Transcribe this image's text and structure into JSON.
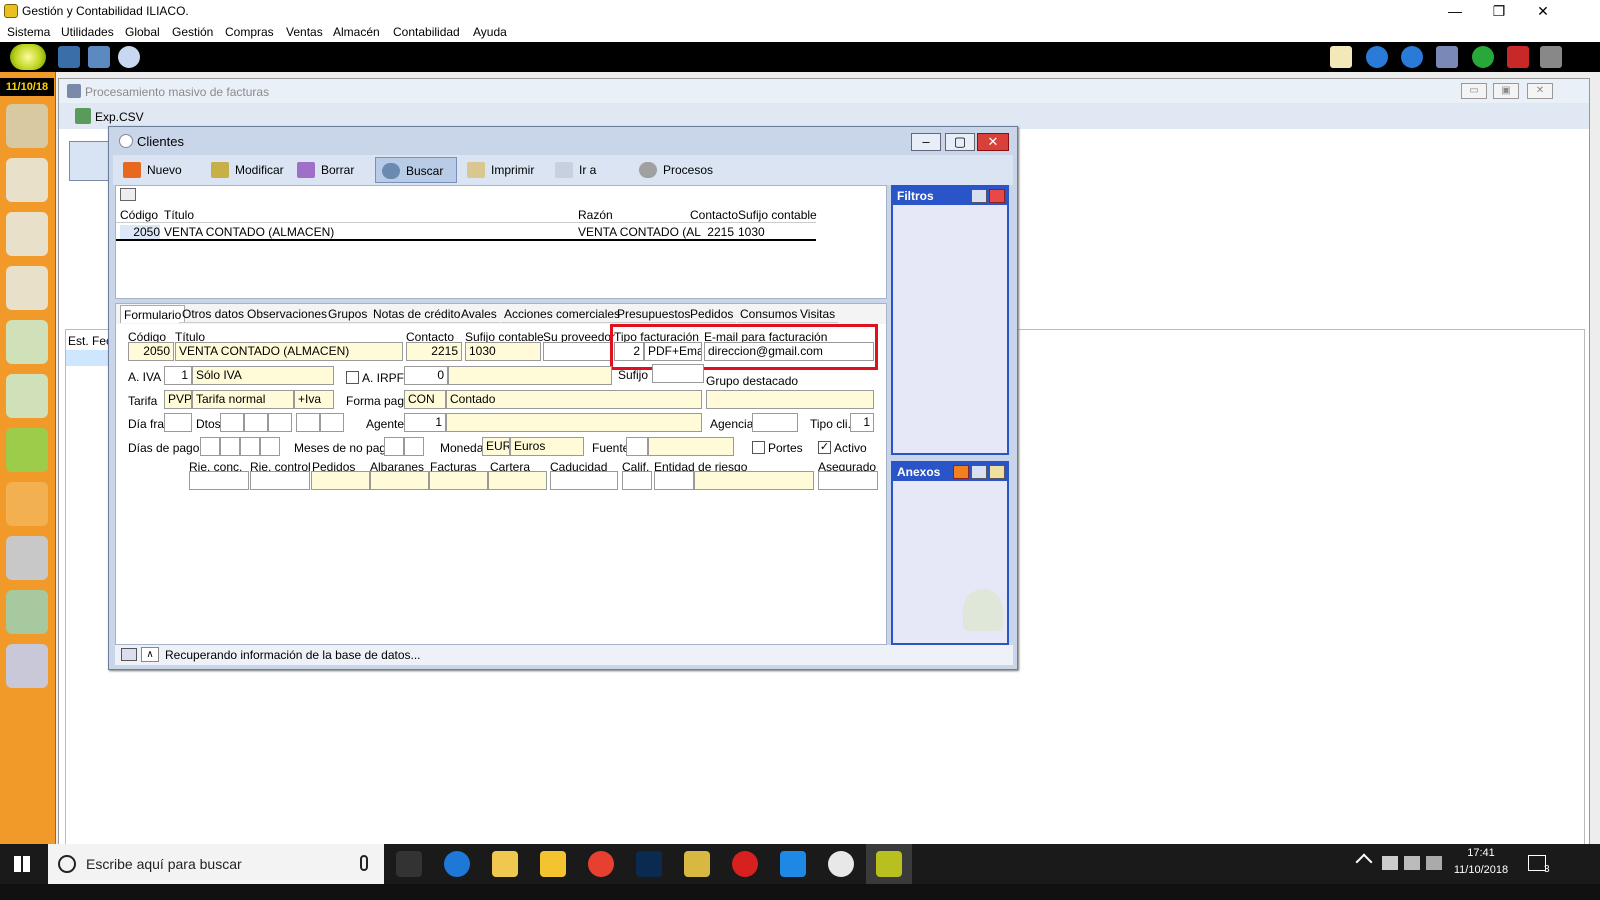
{
  "app": {
    "title": "Gestión y Contabilidad ILIACO.",
    "minimize": "—",
    "maximize": "❐",
    "close": "✕"
  },
  "menu": [
    "Sistema",
    "Utilidades",
    "Global",
    "Gestión",
    "Compras",
    "Ventas",
    "Almacén",
    "Contabilidad",
    "Ayuda"
  ],
  "launcher": {
    "date": "11/10/18"
  },
  "proc_window": {
    "title": "Procesamiento masivo de facturas",
    "export_label": "Exp.CSV",
    "grid_cols": [
      "Est.",
      "Fec"
    ],
    "btn_min": "▭",
    "btn_max": "▣",
    "btn_close": "✕"
  },
  "clientes": {
    "title": "Clientes",
    "btn_min": "–",
    "btn_max": "▢",
    "btn_close": "✕",
    "toolbar": [
      "Nuevo",
      "Modificar",
      "Borrar",
      "Buscar",
      "Imprimir",
      "Ir a",
      "Procesos"
    ],
    "list": {
      "columns": [
        "Código",
        "Título",
        "Razón",
        "Contacto",
        "Sufijo contable"
      ],
      "rows": [
        {
          "codigo": "2050",
          "titulo": "VENTA CONTADO (ALMACEN)",
          "razon": "VENTA CONTADO (AL",
          "contacto": "2215",
          "sufijo": "1030"
        }
      ]
    },
    "tabs": [
      "Formulario",
      "Otros datos",
      "Observaciones",
      "Grupos",
      "Notas de crédito",
      "Avales",
      "Acciones comerciales",
      "Presupuestos",
      "Pedidos",
      "Consumos",
      "Visitas"
    ],
    "form": {
      "codigo_label": "Código",
      "codigo": "2050",
      "titulo_label": "Título",
      "titulo": "VENTA CONTADO (ALMACEN)",
      "contacto_label": "Contacto",
      "contacto": "2215",
      "sufijo_label": "Sufijo contable",
      "sufijo": "1030",
      "proveedor_label": "Su proveedor",
      "proveedor": "",
      "tipo_fact_label": "Tipo facturación",
      "tipo_fact_num": "2",
      "tipo_fact": "PDF+Email",
      "email_label": "E-mail para facturación",
      "email": "direccion@gmail.com",
      "aiva_label": "A. IVA",
      "aiva_num": "1",
      "aiva": "Sólo IVA",
      "airpf_label": "A. IRPF",
      "airpf": "0",
      "sufijo2_label": "Sufijo",
      "grupo_label": "Grupo destacado",
      "tarifa_label": "Tarifa",
      "tarifa_code": "PVP",
      "tarifa": "Tarifa normal",
      "tarifa_iva": "+Iva",
      "formapago_label": "Forma pago",
      "formapago_code": "CON",
      "formapago": "Contado",
      "diafra_label": "Día fra",
      "dtos_label": "Dtos",
      "agente_label": "Agente",
      "agente": "1",
      "agencia_label": "Agencia",
      "tipocli_label": "Tipo cli.",
      "tipocli": "1",
      "diaspago_label": "Días de pago",
      "mesesnopago_label": "Meses de no pago",
      "moneda_label": "Moneda",
      "moneda_code": "EUR",
      "moneda": "Euros",
      "fuente_label": "Fuente",
      "portes_label": "Portes",
      "portes": "",
      "activo_label": "Activo",
      "activo": "✓",
      "risk_cols": [
        "Rie. conc.",
        "Rie. control",
        "Pedidos",
        "Albaranes",
        "Facturas",
        "Cartera",
        "Caducidad",
        "Calif.",
        "Entidad de riesgo",
        "Asegurado"
      ]
    },
    "filtros_title": "Filtros",
    "anexos_title": "Anexos",
    "status": "Recuperando información de la base de datos..."
  },
  "taskbar": {
    "search_placeholder": "Escribe aquí para buscar",
    "time": "17:41",
    "date": "11/10/2018",
    "notif": "3"
  },
  "colors": {
    "launcher": "#f19a29",
    "panel_blue": "#2a55c8",
    "highlight_red": "#e0101e",
    "field_yellow": "#fffbd8"
  }
}
